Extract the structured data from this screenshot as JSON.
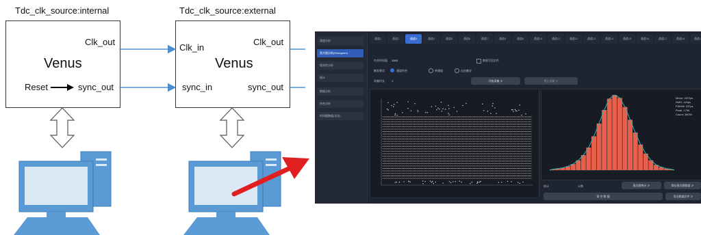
{
  "diagram": {
    "left": {
      "caption": "Tdc_clk_source:internal",
      "title": "Venus",
      "port_out_top": "Clk_out",
      "port_in_bottom": "Reset",
      "port_out_bottom": "sync_out"
    },
    "right": {
      "caption": "Tdc_clk_source:external",
      "title": "Venus",
      "port_in_top": "Clk_in",
      "port_out_top": "Clk_out",
      "port_in_bottom": "sync_in",
      "port_out_bottom": "sync_out"
    },
    "colors": {
      "connector": "#4a90d9",
      "computer_fill": "#5b9bd5",
      "screen_fill": "#dbe8f6",
      "red_arrow": "#e02020"
    }
  },
  "app": {
    "sidebar": [
      "通道分析",
      "直方图分析(Histogram)",
      "相关性分析",
      "统计",
      "数据分析",
      "符合分析",
      "时间戳数据(导出)"
    ],
    "tabs": [
      "通道1",
      "通道2",
      "通道3",
      "通道4",
      "通道5",
      "通道6",
      "通道7",
      "通道8",
      "通道9",
      "通道10",
      "通道11",
      "通道12",
      "通道13",
      "通道14",
      "通道15",
      "通道16",
      "通道17",
      "通道18",
      "通道19"
    ],
    "form": {
      "field1_label": "符合时间窗",
      "field1_value": "1000",
      "checkbox_label": "数据写回文件",
      "mode_label": "触发模式",
      "mode_options": [
        "通道符合",
        "单通道",
        "自由触发"
      ],
      "field2_label": "采集时长",
      "field2_value": "1",
      "button1": "开始采集 ≫",
      "button2": "停止采集 ≫"
    },
    "bottom": {
      "label1": "统计",
      "label2": "计数",
      "button1": "直方图统计 ≫",
      "button2": "保存直方图数据 ≫",
      "button3": "清 空 数 据",
      "button4": "导出数据文件 ≫"
    },
    "stats": [
      "Mean: 1872ps",
      "RMS: 143ps",
      "FWHM: 337ps",
      "Peak: 1795",
      "Count: 28000"
    ],
    "colors": {
      "bg": "#1f2530",
      "accent": "#3a6bd0",
      "bar": "#e8604c",
      "fit_curve": "#2fb5b5",
      "scatter": "#f0a060"
    }
  },
  "chart_data": {
    "type": "bar",
    "title": "",
    "xlabel": "",
    "ylabel": "",
    "values": [
      1,
      2,
      3,
      5,
      8,
      13,
      20,
      30,
      45,
      62,
      80,
      95,
      100,
      96,
      84,
      67,
      50,
      34,
      22,
      13,
      7,
      4,
      2,
      1
    ]
  }
}
